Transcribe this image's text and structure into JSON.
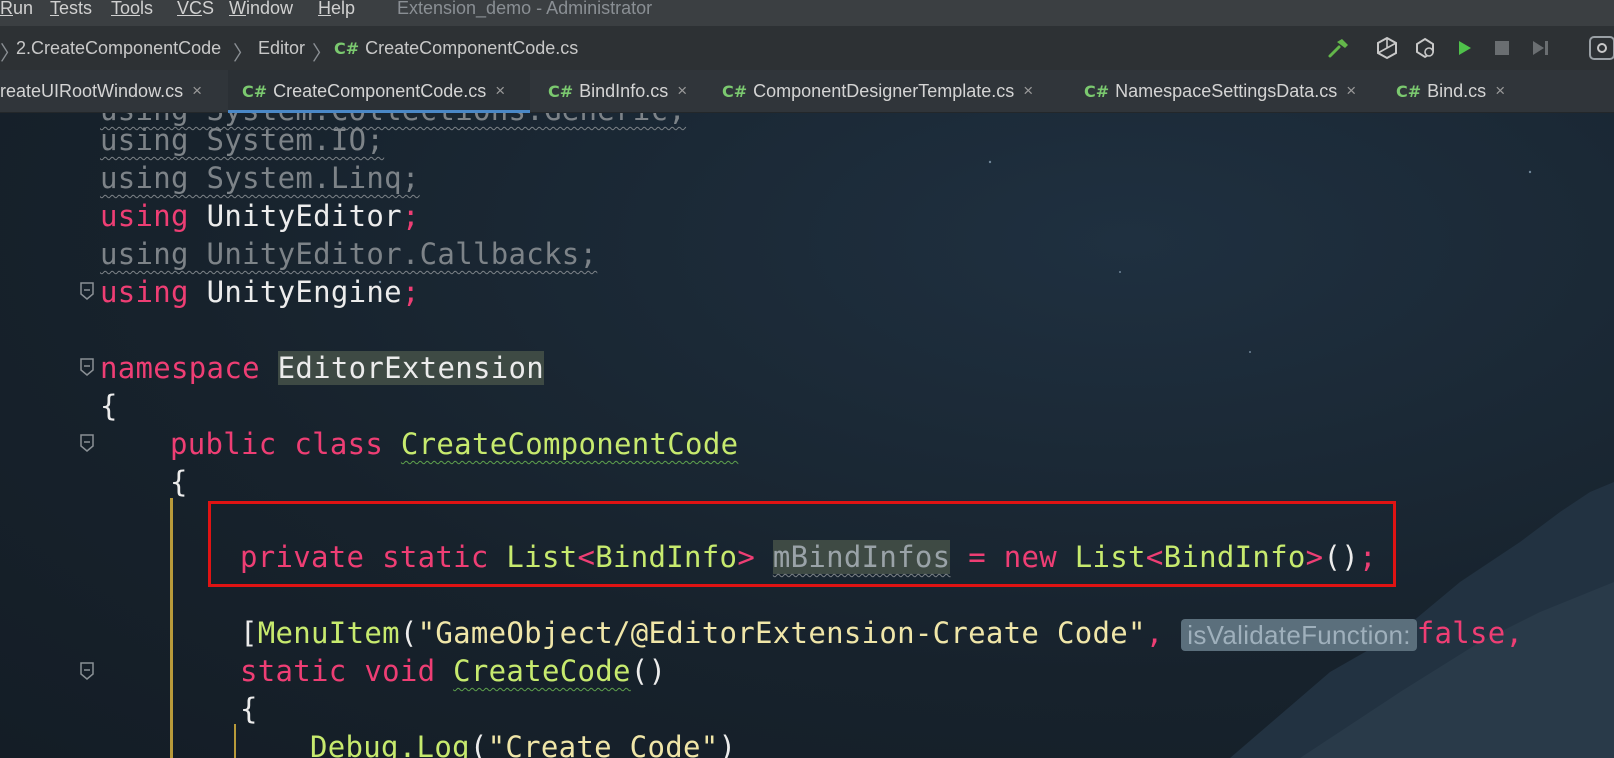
{
  "menubar": {
    "items": [
      {
        "key": "R",
        "rest": "un"
      },
      {
        "key": "T",
        "rest": "ests"
      },
      {
        "key": "Too",
        "rest": "ls"
      },
      {
        "key": "VC",
        "rest": "S"
      },
      {
        "key": "W",
        "rest": "indow"
      },
      {
        "key": "H",
        "rest": "elp"
      }
    ],
    "window_title": "Extension_demo - Administrator"
  },
  "breadcrumb": {
    "items": [
      "2.CreateComponentCode",
      "Editor",
      "CreateComponentCode.cs"
    ],
    "file_badge": "C#"
  },
  "tabs": [
    {
      "label": "reateUIRootWindow.cs",
      "badge": "",
      "active": false
    },
    {
      "label": "CreateComponentCode.cs",
      "badge": "C#",
      "active": true
    },
    {
      "label": "BindInfo.cs",
      "badge": "C#",
      "active": false
    },
    {
      "label": "ComponentDesignerTemplate.cs",
      "badge": "C#",
      "active": false
    },
    {
      "label": "NamespaceSettingsData.cs",
      "badge": "C#",
      "active": false
    },
    {
      "label": "Bind.cs",
      "badge": "C#",
      "active": false
    }
  ],
  "tab_close_glyph": "×",
  "code": {
    "l0": "using System.Collections.Generic;",
    "l1": "using System.IO;",
    "l2": "using System.Linq;",
    "l3_kw": "using",
    "l3_id": "UnityEditor",
    "l4": "using UnityEditor.Callbacks;",
    "l5_kw": "using",
    "l5_id": "UnityEngine",
    "semi": ";",
    "l7_kw": "namespace",
    "l7_id": "EditorExtension",
    "open": "{",
    "l9_kw1": "public",
    "l9_kw2": "class",
    "l9_id": "CreateComponentCode",
    "l12_kw1": "private",
    "l12_kw2": "static",
    "l12_ty1": "List",
    "l12_ty2": "BindInfo",
    "l12_field": "mBindInfos",
    "l12_eq": " = ",
    "l12_kw3": "new",
    "l12_ty3": "List",
    "l12_ty4": "BindInfo",
    "l12_end": "()",
    "lt": "<",
    "gt": ">",
    "l14_br": "[",
    "l14_attr": "MenuItem",
    "l14_paren": "(",
    "l14_str": "\"GameObject/@EditorExtension-Create Code\"",
    "l14_comma": ", ",
    "l14_hint": "isValidateFunction:",
    "l14_false": "false",
    "l14_comma2": ",",
    "l15_kw1": "static",
    "l15_kw2": "void",
    "l15_id": "CreateCode",
    "l15_parens": "()",
    "l17_call": "Debug.Log",
    "l17_paren": "(",
    "l17_str": "\"Create Code\"",
    "l17_end": ")"
  },
  "colors": {
    "keyword": "#ee3e74",
    "type": "#c7ea6e",
    "string": "#f0e6a8",
    "highlight_box": "#e01313",
    "tab_active_underline": "#4a88c7"
  }
}
